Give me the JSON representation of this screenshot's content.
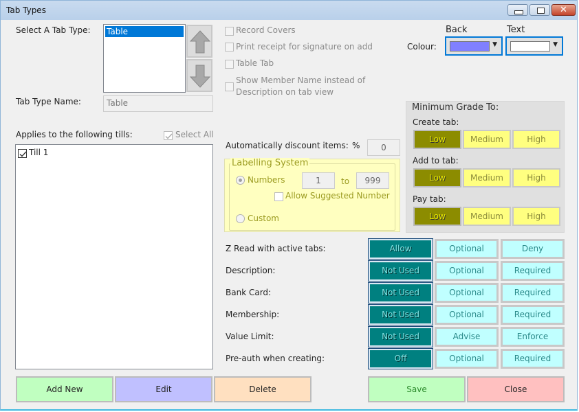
{
  "window": {
    "title": "Tab Types",
    "controls": {
      "minimize": "minimize",
      "maximize": "maximize",
      "close": "✕"
    }
  },
  "tab_type": {
    "select_label": "Select A Tab Type:",
    "list_items": [
      "Table"
    ],
    "selected_item": "Table",
    "name_label": "Tab Type Name:",
    "name_value": "Table"
  },
  "options": {
    "record_covers": {
      "label": "Record Covers",
      "checked": false
    },
    "print_receipt": {
      "label": "Print receipt for signature on add",
      "checked": false
    },
    "table_tab": {
      "label": "Table Tab",
      "checked": false
    },
    "show_member_line1": "Show Member Name instead of",
    "show_member_line2": "Description on tab view"
  },
  "colour": {
    "label": "Colour:",
    "back_label": "Back",
    "text_label": "Text",
    "back_color": "#8080ff",
    "text_color": "#ffffff"
  },
  "tills": {
    "label": "Applies to the following tills:",
    "select_all_label": "Select All",
    "select_all_checked": true,
    "items": [
      {
        "label": "Till 1",
        "checked": true
      }
    ]
  },
  "discount": {
    "label": "Automatically discount items:",
    "percent_symbol": "%",
    "value": "0"
  },
  "labelling": {
    "legend": "Labelling System",
    "numbers_label": "Numbers",
    "numbers_selected": true,
    "from": "1",
    "to_label": "to",
    "to": "999",
    "allow_suggested_label": "Allow Suggested Number",
    "allow_suggested_checked": false,
    "custom_label": "Custom"
  },
  "min_grade": {
    "title": "Minimum Grade To:",
    "rows": [
      {
        "label": "Create tab:",
        "options": [
          "Low",
          "Medium",
          "High"
        ],
        "selected": "Low"
      },
      {
        "label": "Add to tab:",
        "options": [
          "Low",
          "Medium",
          "High"
        ],
        "selected": "Low"
      },
      {
        "label": "Pay tab:",
        "options": [
          "Low",
          "Medium",
          "High"
        ],
        "selected": "Low"
      }
    ]
  },
  "settings": [
    {
      "label": "Z Read with active tabs:",
      "options": [
        "Allow",
        "Optional",
        "Deny"
      ],
      "selected": "Allow"
    },
    {
      "label": "Description:",
      "options": [
        "Not Used",
        "Optional",
        "Required"
      ],
      "selected": "Not Used"
    },
    {
      "label": "Bank Card:",
      "options": [
        "Not Used",
        "Optional",
        "Required"
      ],
      "selected": "Not Used"
    },
    {
      "label": "Membership:",
      "options": [
        "Not Used",
        "Optional",
        "Required"
      ],
      "selected": "Not Used"
    },
    {
      "label": "Value Limit:",
      "options": [
        "Not Used",
        "Advise",
        "Enforce"
      ],
      "selected": "Not Used"
    },
    {
      "label": "Pre-auth when creating:",
      "options": [
        "Off",
        "Optional",
        "Required"
      ],
      "selected": "Off"
    }
  ],
  "buttons": {
    "add_new": "Add New",
    "edit": "Edit",
    "delete": "Delete",
    "save": "Save",
    "close": "Close"
  },
  "colors": {
    "grade_selected": "#8c8c00",
    "grade_unselected": "#ffff80",
    "option_selected": "#008080",
    "option_unselected": "#c0ffff",
    "add_new_bg": "#c0ffc0",
    "edit_bg": "#c0c0ff",
    "delete_bg": "#ffe0c0",
    "save_bg": "#c0ffc0",
    "close_bg": "#ffc0c0"
  }
}
